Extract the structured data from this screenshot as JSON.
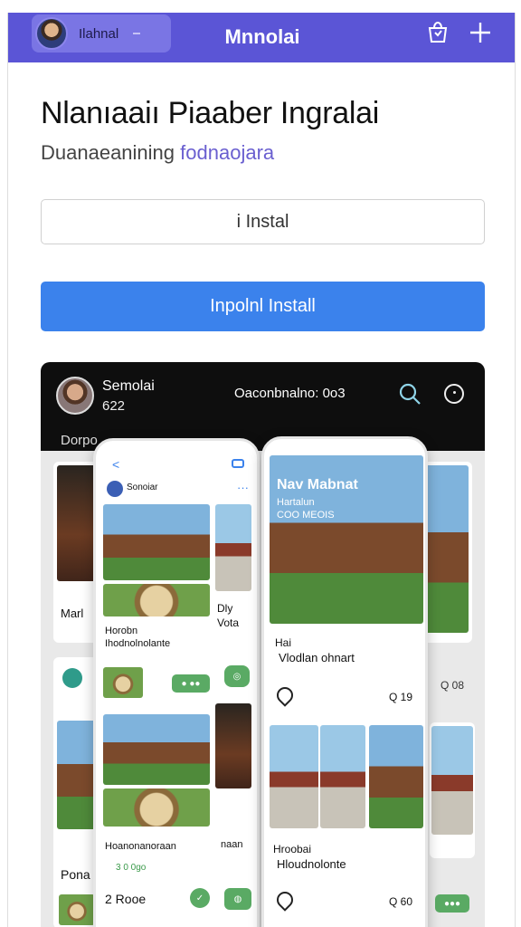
{
  "topbar": {
    "user_name": "Ilahnal",
    "app_title": "Mnnolai",
    "bag_icon": "shopping-bag-icon",
    "add_icon": "plus-icon",
    "bg_color": "#5b55d6"
  },
  "main": {
    "title": "Nlanıaaiı Piaaber Ingralai",
    "subtitle_text": "Duanaeanining",
    "subtitle_link": "fodnaojara",
    "install_box": "i Instal",
    "install_button": "Inpolnl Install",
    "button_color": "#3b82ec"
  },
  "preview": {
    "user_name": "Semolai",
    "user_sub": "622",
    "count_text": "Oaconbnalno: 0o3",
    "tab_text": "Dorpo",
    "left_bg": {
      "label1": "Marl",
      "label2": "Pona"
    },
    "phone1": {
      "back": "<",
      "user": "Sonoiar",
      "more": "···",
      "card1_title": "Horobn",
      "card1_sub": "Ihodnolnolante",
      "card2_title": "Hoanonanoraan",
      "card2_sub": "3 0 0go",
      "footer": "2 Rooe"
    },
    "phone2": {
      "hero_title": "Nav Mabnat",
      "hero_sub1": "Hartalun",
      "hero_sub2": "COO MEOIS",
      "label": "Hai",
      "title": "Vlodlan ohnart",
      "count": "Q 19",
      "bottom_title": "Hroobai",
      "bottom_sub": "Hloudnolonte",
      "bottom_count": "Q 60"
    },
    "right_bg": {
      "col1": "Dly",
      "col2": "Vota",
      "count": "Q 08",
      "label": "naan"
    }
  }
}
